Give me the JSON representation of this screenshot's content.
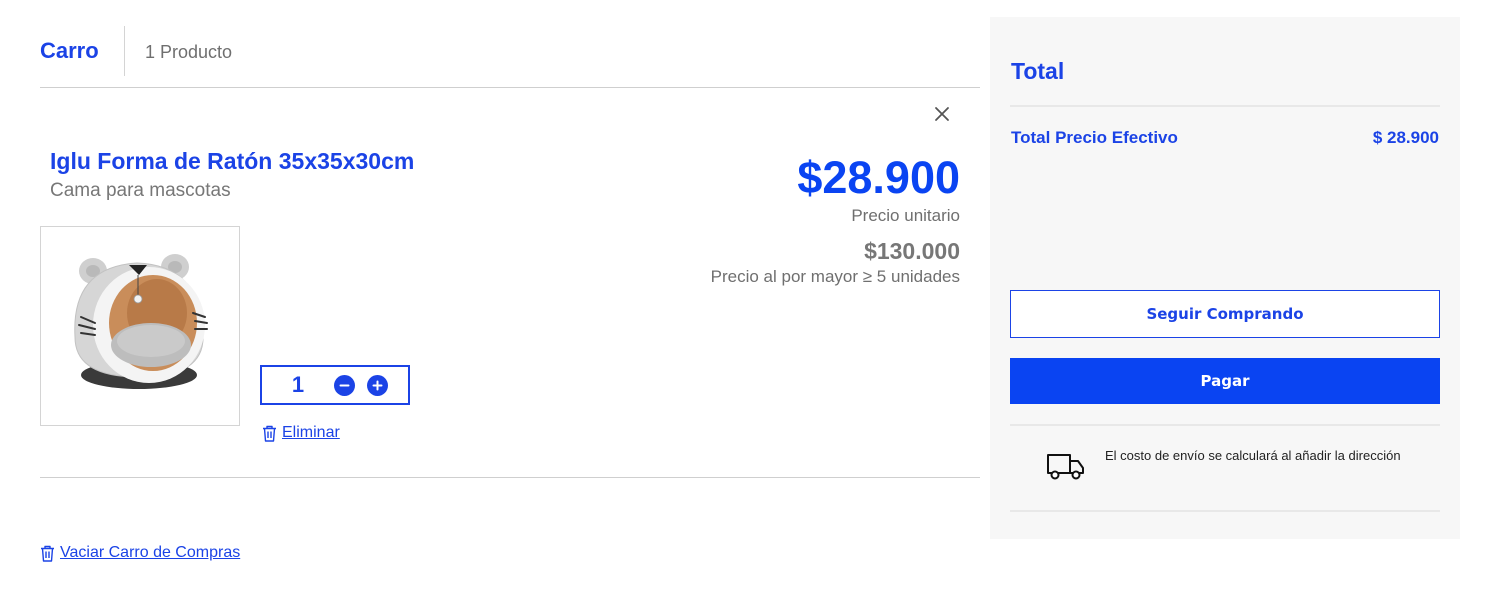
{
  "header": {
    "title": "Carro",
    "count": "1 Producto"
  },
  "item": {
    "name": "Iglu Forma de Ratón 35x35x30cm",
    "category": "Cama para mascotas",
    "price": "$28.900",
    "price_label": "Precio unitario",
    "wholesale_price": "$130.000",
    "wholesale_label": "Precio al por mayor ≥ 5 unidades",
    "quantity": "1",
    "remove_label": "Eliminar"
  },
  "empty_cart_label": "Vaciar Carro de Compras",
  "summary": {
    "title": "Total",
    "total_label": "Total Precio Efectivo",
    "total_value": "$ 28.900",
    "continue_label": "Seguir Comprando",
    "pay_label": "Pagar",
    "shipping_note": "El costo de envío se calculará al añadir la dirección"
  },
  "colors": {
    "accent": "#1b43e6",
    "pay_button": "#0a44f2",
    "summary_bg": "#f7f7f7"
  },
  "icons": [
    "close-icon",
    "minus-icon",
    "plus-icon",
    "trash-icon",
    "truck-icon",
    "pet-bed-image"
  ]
}
